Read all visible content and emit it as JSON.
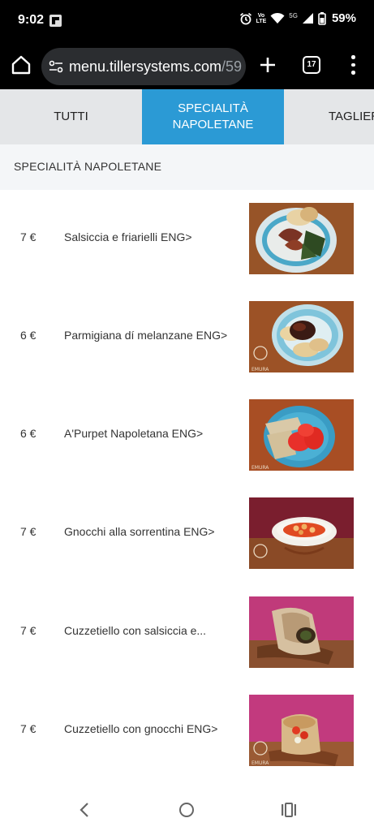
{
  "status_bar": {
    "time": "9:02",
    "volte": "Vo LTE",
    "network": "5G",
    "battery": "59%"
  },
  "browser": {
    "url_main": "menu.tillersystems.com",
    "url_rest": "/59",
    "tab_count": "17"
  },
  "categories": {
    "tabs": [
      {
        "label": "TUTTI"
      },
      {
        "label": "SPECIALITÀ NAPOLETANE"
      },
      {
        "label": "TAGLIER"
      }
    ],
    "active_color": "#2b9ad5"
  },
  "section": {
    "title": "SPECIALITÀ NAPOLETANE"
  },
  "menu_items": [
    {
      "price": "7 €",
      "name": "Salsiccia e friarielli ENG>",
      "photo_icon": "sausage-dish-photo"
    },
    {
      "price": "6 €",
      "name": "Parmigiana dí melanzane ENG>",
      "photo_icon": "parmigiana-dish-photo"
    },
    {
      "price": "6 €",
      "name": "A'Purpet Napoletana ENG>",
      "photo_icon": "meatball-dish-photo"
    },
    {
      "price": "7 €",
      "name": "Gnocchi alla sorrentina ENG>",
      "photo_icon": "gnocchi-dish-photo"
    },
    {
      "price": "7 €",
      "name": "Cuzzetiello con salsiccia e...",
      "photo_icon": "cuzzetiello-sausage-photo"
    },
    {
      "price": "7 €",
      "name": "Cuzzetiello con gnocchi ENG>",
      "photo_icon": "cuzzetiello-gnocchi-photo"
    }
  ]
}
